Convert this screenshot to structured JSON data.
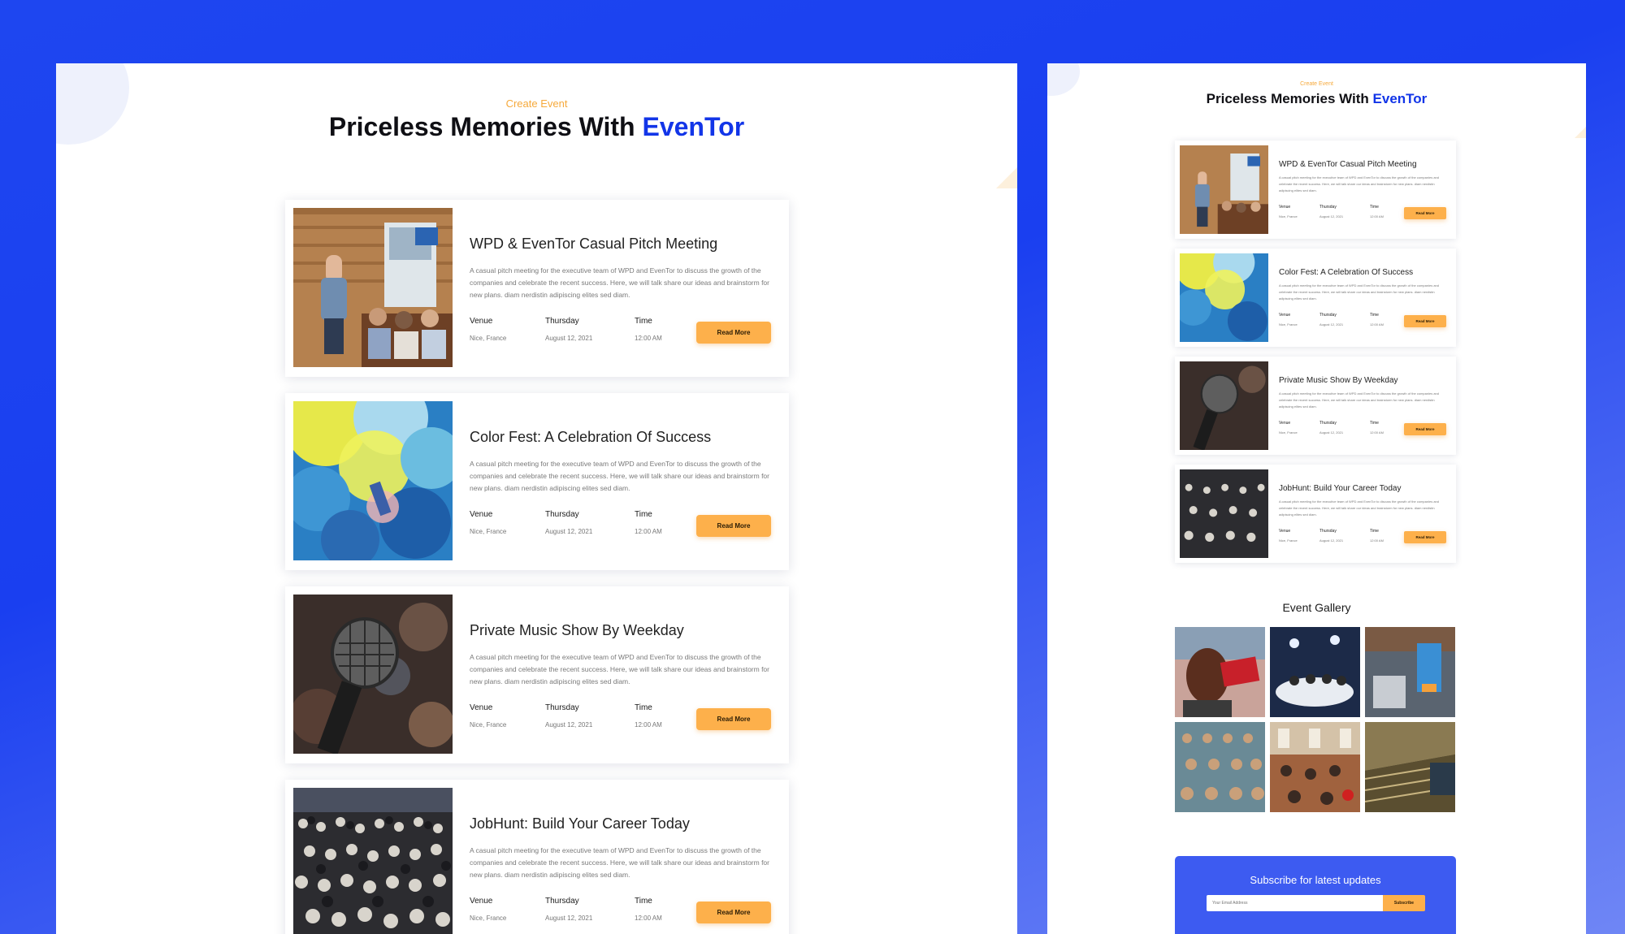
{
  "colors": {
    "background": "#1e46f0",
    "brand": "#1235e8",
    "accent": "#fdb04b",
    "eyebrow": "#f6a93b",
    "subscribe_bg": "#3d5bf1"
  },
  "header": {
    "eyebrow": "Create Event",
    "title_prefix": "Priceless Memories With ",
    "title_brand": "EvenTor"
  },
  "events": [
    {
      "title": "WPD & EvenTor Casual Pitch Meeting",
      "description": "A casual pitch meeting for the executive team of WPD and EvenTor to discuss the growth of the companies and celebrate the recent success. Here, we will talk share our ideas and brainstorm for new plans. diam nerdistin adipiscing elites sed diam.",
      "venue_label": "Venue",
      "venue": "Nice, France",
      "day": "Thursday",
      "date": "August 12, 2021",
      "time_label": "Time",
      "time": "12:00 AM",
      "button": "Read More",
      "image": "pitch-meeting-photo"
    },
    {
      "title": "Color Fest: A Celebration Of Success",
      "description": "A casual pitch meeting for the executive team of WPD and EvenTor to discuss the growth of the companies and celebrate the recent success. Here, we will talk share our ideas and brainstorm for new plans. diam nerdistin adipiscing elites sed diam.",
      "venue_label": "Venue",
      "venue": "Nice, France",
      "day": "Thursday",
      "date": "August 12, 2021",
      "time_label": "Time",
      "time": "12:00 AM",
      "button": "Read More",
      "image": "color-fest-photo"
    },
    {
      "title": "Private Music Show By Weekday",
      "description": "A casual pitch meeting for the executive team of WPD and EvenTor to discuss the growth of the companies and celebrate the recent success. Here, we will talk share our ideas and brainstorm for new plans. diam nerdistin adipiscing elites sed diam.",
      "venue_label": "Venue",
      "venue": "Nice, France",
      "day": "Thursday",
      "date": "August 12, 2021",
      "time_label": "Time",
      "time": "12:00 AM",
      "button": "Read More",
      "image": "microphone-photo"
    },
    {
      "title": "JobHunt: Build Your Career Today",
      "description": "A casual pitch meeting for the executive team of WPD and EvenTor to discuss the growth of the companies and celebrate the recent success. Here, we will talk share our ideas and brainstorm for new plans. diam nerdistin adipiscing elites sed diam.",
      "venue_label": "Venue",
      "venue": "Nice, France",
      "day": "Thursday",
      "date": "August 12, 2021",
      "time_label": "Time",
      "time": "12:00 AM",
      "button": "Read More",
      "image": "crowd-photo"
    }
  ],
  "gallery": {
    "title": "Event Gallery",
    "images": [
      "megaphone-photo",
      "stage-panel-photo",
      "banner-hall-photo",
      "auditorium-seats-photo",
      "conference-room-photo",
      "lecture-hall-photo"
    ]
  },
  "subscribe": {
    "title": "Subscribe for latest updates",
    "placeholder": "Your Email Address",
    "button": "Subscribe"
  }
}
